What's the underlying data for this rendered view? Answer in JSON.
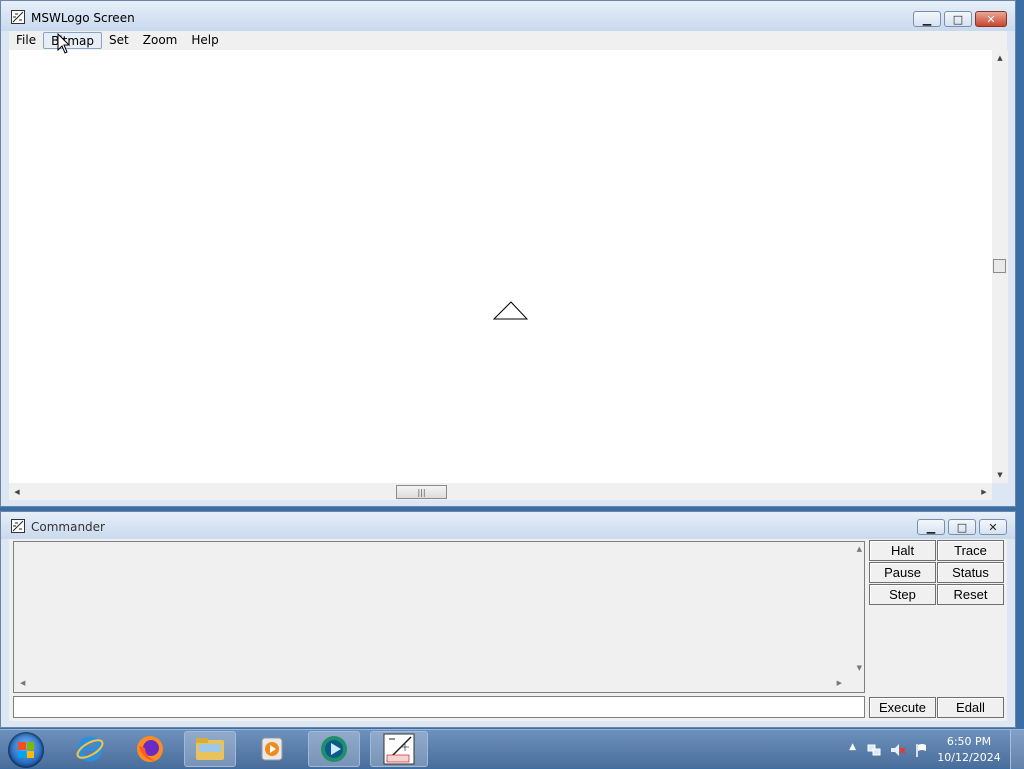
{
  "screen_window": {
    "title": "MSWLogo Screen",
    "caption_buttons": {
      "minimize": "▁",
      "maximize": "□",
      "close": "✕"
    },
    "menu": [
      "File",
      "Bitmap",
      "Set",
      "Zoom",
      "Help"
    ],
    "scroll_glyphs": {
      "up": "▲",
      "down": "▼",
      "left": "◀",
      "right": "▶",
      "grip": "|||"
    }
  },
  "commander_window": {
    "title": "Commander",
    "caption_buttons": {
      "minimize": "▁",
      "maximize": "□",
      "close": "✕"
    },
    "buttons": {
      "halt": "Halt",
      "trace": "Trace",
      "pause": "Pause",
      "status": "Status",
      "step": "Step",
      "reset": "Reset",
      "execute": "Execute",
      "edall": "Edall"
    },
    "input_value": ""
  },
  "taskbar": {
    "clock_time": "6:50 PM",
    "clock_date": "10/12/2024",
    "tray_chevron": "▲"
  }
}
